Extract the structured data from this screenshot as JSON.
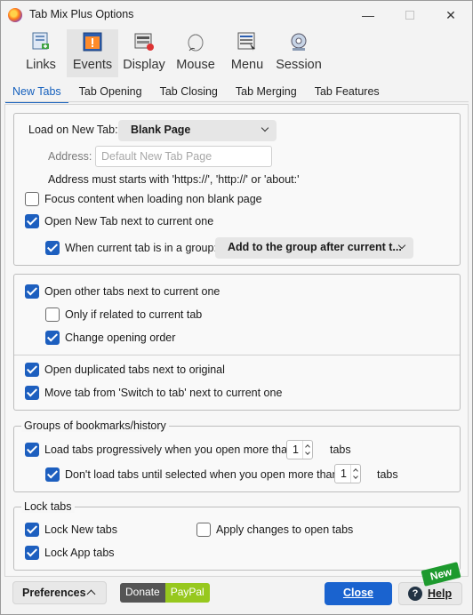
{
  "window": {
    "title": "Tab Mix Plus Options",
    "minimize": "—",
    "close": "✕"
  },
  "categories": [
    {
      "label": "Links"
    },
    {
      "label": "Events"
    },
    {
      "label": "Display"
    },
    {
      "label": "Mouse"
    },
    {
      "label": "Menu"
    },
    {
      "label": "Session"
    }
  ],
  "active_category": "Events",
  "subtabs": [
    {
      "label": "New Tabs"
    },
    {
      "label": "Tab Opening"
    },
    {
      "label": "Tab Closing"
    },
    {
      "label": "Tab Merging"
    },
    {
      "label": "Tab Features"
    }
  ],
  "active_subtab": "New Tabs",
  "new_tab": {
    "load_label": "Load on New Tab:",
    "load_value": "Blank Page",
    "address_label": "Address:",
    "address_placeholder": "Default New Tab Page",
    "address_hint": "Address must starts with 'https://', 'http://' or 'about:'",
    "focus_content": {
      "label": "Focus content when loading non blank page",
      "checked": false
    },
    "open_next": {
      "label": "Open New Tab next to current one",
      "checked": true
    },
    "group": {
      "label": "When current tab is in a group:",
      "checked": true,
      "value": "Add to the group after current t..."
    }
  },
  "opening": {
    "open_other": {
      "label": "Open other tabs next to current one",
      "checked": true
    },
    "only_related": {
      "label": "Only if related to current tab",
      "checked": false
    },
    "change_order": {
      "label": "Change opening order",
      "checked": true
    },
    "duplicated": {
      "label": "Open duplicated tabs next to original",
      "checked": true
    },
    "switch_to_tab": {
      "label": "Move tab from 'Switch to tab' next to current one",
      "checked": true
    }
  },
  "groups": {
    "title": "Groups of bookmarks/history",
    "progressive": {
      "label": "Load tabs progressively when you open more than",
      "checked": true,
      "value": "1",
      "unit": "tabs"
    },
    "dont_load": {
      "label": "Don't load tabs until selected when you open more than",
      "checked": true,
      "value": "1",
      "unit": "tabs"
    }
  },
  "lock": {
    "title": "Lock tabs",
    "lock_new": {
      "label": "Lock New tabs",
      "checked": true
    },
    "lock_app": {
      "label": "Lock App tabs",
      "checked": true
    },
    "apply_open": {
      "label": "Apply changes to open tabs",
      "checked": false
    }
  },
  "footer": {
    "preferences": "Preferences",
    "donate": "Donate",
    "paypal": "PayPal",
    "close": "Close",
    "help": "Help",
    "help_glyph": "?",
    "new_badge": "New"
  },
  "colors": {
    "accent": "#1d5fbf",
    "badge": "#1d9a2e",
    "paypal": "#97c81e"
  }
}
